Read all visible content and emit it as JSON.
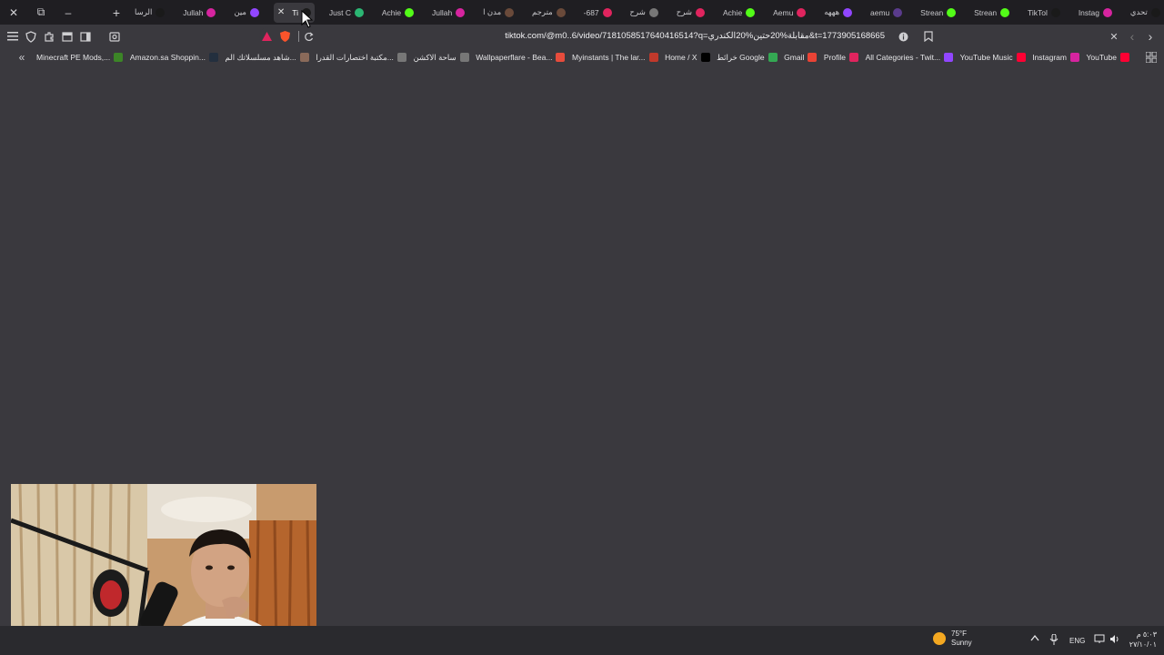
{
  "tabs": [
    {
      "label": "تحدي",
      "icon": "tiktok-icon",
      "color": "#1a1a1a"
    },
    {
      "label": "Instag",
      "icon": "instagram-icon",
      "color": "#d6249f"
    },
    {
      "label": "TikTol",
      "icon": "tiktok-icon",
      "color": "#1a1a1a"
    },
    {
      "label": "Strean",
      "icon": "kick-icon",
      "color": "#53fc18"
    },
    {
      "label": "Strean",
      "icon": "kick-icon",
      "color": "#53fc18"
    },
    {
      "label": "aemu",
      "icon": "generic-site-icon",
      "color": "#5a3b8c"
    },
    {
      "label": "هههه",
      "icon": "twitch-icon",
      "color": "#9146ff"
    },
    {
      "label": "Aemu",
      "icon": "youtube-icon",
      "color": "#e0245e"
    },
    {
      "label": "Achie",
      "icon": "kick-icon",
      "color": "#53fc18"
    },
    {
      "label": "شرح",
      "icon": "youtube-icon",
      "color": "#e0245e"
    },
    {
      "label": "شرح",
      "icon": "generic-site-icon",
      "color": "#777777"
    },
    {
      "label": "-687",
      "icon": "youtube-icon",
      "color": "#e0245e"
    },
    {
      "label": "مترجم",
      "icon": "generic-site-icon",
      "color": "#6a4a3a"
    },
    {
      "label": "مدن ا",
      "icon": "generic-site-icon",
      "color": "#6a4a3a"
    },
    {
      "label": "Jullah",
      "icon": "instagram-icon",
      "color": "#d6249f"
    },
    {
      "label": "Achie",
      "icon": "kick-icon",
      "color": "#53fc18"
    },
    {
      "label": "Just C",
      "icon": "chatgpt-icon",
      "color": "#2bb673"
    },
    {
      "label": "Ti",
      "icon": "tiktok-icon",
      "color": "#1a1a1a",
      "active": true
    },
    {
      "label": "مين",
      "icon": "twitch-icon",
      "color": "#9146ff"
    },
    {
      "label": "Jullah",
      "icon": "instagram-icon",
      "color": "#d6249f"
    },
    {
      "label": "الرسا",
      "icon": "tiktok-icon",
      "color": "#1a1a1a"
    }
  ],
  "window": {
    "new_tab": "+",
    "minimize": "–",
    "restore": "⧉",
    "close": "✕"
  },
  "address": {
    "url": "tiktok.com/@m0..6/video/7181058517640416514?q=مقابلة%20حتين%20الكندري&t=1773905168665"
  },
  "toolbar": {
    "close_label": "✕",
    "back_label": "‹",
    "forward_label": "›",
    "collapse_label": "«"
  },
  "bookmarks": [
    {
      "label": "YouTube",
      "icon": "youtube-icon",
      "color": "#ff0033"
    },
    {
      "label": "Instagram",
      "icon": "instagram-icon",
      "color": "#d6249f"
    },
    {
      "label": "YouTube Music",
      "icon": "youtube-music-icon",
      "color": "#ff0033"
    },
    {
      "label": "All Categories - Twit...",
      "icon": "twitch-icon",
      "color": "#9146ff"
    },
    {
      "label": "Profile",
      "icon": "profile-icon",
      "color": "#e0245e"
    },
    {
      "label": "Gmail",
      "icon": "gmail-icon",
      "color": "#ea4335"
    },
    {
      "label": "خرائط Google",
      "icon": "maps-icon",
      "color": "#34a853"
    },
    {
      "label": "Home / X",
      "icon": "x-icon",
      "color": "#000000"
    },
    {
      "label": "Myinstants | The lar...",
      "icon": "myinstants-icon",
      "color": "#c0392b"
    },
    {
      "label": "Wallpaperflare - Bea...",
      "icon": "wallpaperflare-icon",
      "color": "#e74c3c"
    },
    {
      "label": "ساحة الاكشن",
      "icon": "generic-site-icon",
      "color": "#777777"
    },
    {
      "label": "مكتبة اختصارات القدرا...",
      "icon": "generic-site-icon",
      "color": "#777777"
    },
    {
      "label": "شاهد مسلسلاتك الم...",
      "icon": "generic-site-icon",
      "color": "#8a6a5a"
    },
    {
      "label": "Amazon.sa Shoppin...",
      "icon": "amazon-icon",
      "color": "#232f3e"
    },
    {
      "label": "Minecraft PE Mods,...",
      "icon": "minecraft-icon",
      "color": "#3c8527"
    }
  ],
  "taskbar": {
    "temperature": "75°F",
    "condition": "Sunny",
    "language": "ENG",
    "time": "٥:٠٣ م",
    "date": "٢٧/١٠/٠١"
  }
}
